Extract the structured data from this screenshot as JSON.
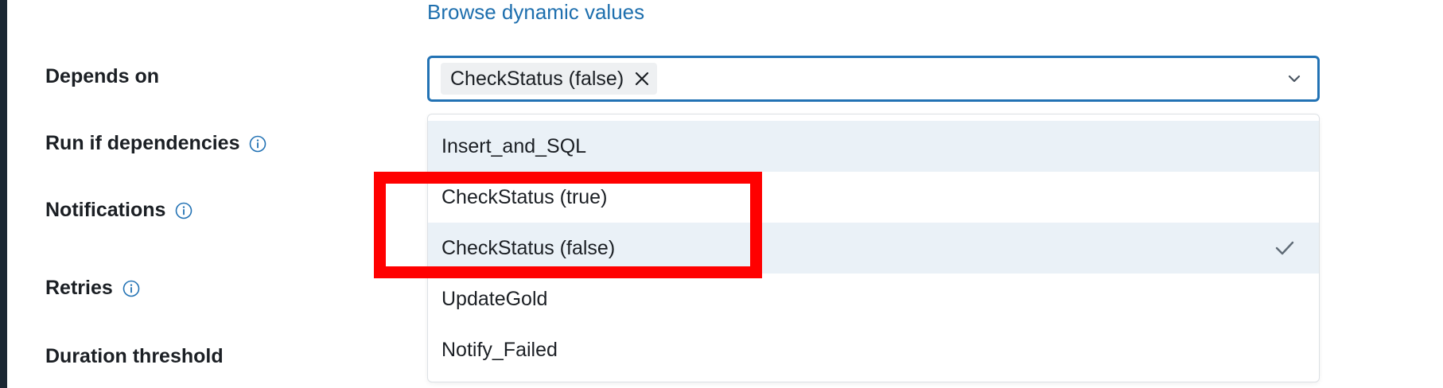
{
  "browse_link": "Browse dynamic values",
  "labels": {
    "depends_on": "Depends on",
    "run_if": "Run if dependencies",
    "notifications": "Notifications",
    "retries": "Retries",
    "duration_threshold": "Duration threshold"
  },
  "depends_select": {
    "chips": [
      {
        "label": "CheckStatus (false)"
      }
    ]
  },
  "dropdown": {
    "options": [
      {
        "label": "Insert_and_SQL",
        "state": "hover"
      },
      {
        "label": "CheckStatus (true)",
        "state": "none"
      },
      {
        "label": "CheckStatus (false)",
        "state": "selected"
      },
      {
        "label": "UpdateGold",
        "state": "none"
      },
      {
        "label": "Notify_Failed",
        "state": "none"
      }
    ]
  },
  "colors": {
    "accent": "#2272b4",
    "link": "#1e6fae",
    "highlight_row": "#eaf1f7",
    "annotation": "#ff0000",
    "left_edge": "#1b2733"
  },
  "icons": {
    "info": "info-icon",
    "chip_remove": "close-icon",
    "chevron": "chevron-down-icon",
    "check": "check-icon"
  }
}
